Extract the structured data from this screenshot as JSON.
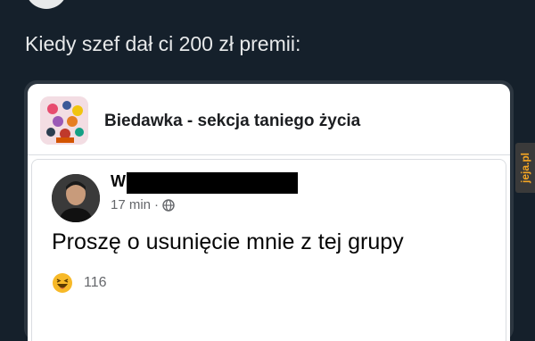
{
  "header": {
    "truncated_text": "...[...]"
  },
  "tweet": {
    "text": "Kiedy szef dał ci 200 zł premii:"
  },
  "group": {
    "name": "Biedawka - sekcja taniego życia",
    "icon": "group-collage-icon"
  },
  "post": {
    "author_initial": "W",
    "time": "17 min",
    "separator": "·",
    "privacy_icon": "globe-icon",
    "text": "Proszę o usunięcie mnie z tej grupy",
    "reaction_icon": "haha-emoji-icon",
    "reaction_count": "116"
  },
  "watermark": {
    "text": "jeja.pl",
    "color": "#f5a623"
  },
  "colors": {
    "background": "#15202b",
    "card": "#ffffff",
    "text_dark": "#050505",
    "text_muted": "#65676b"
  }
}
